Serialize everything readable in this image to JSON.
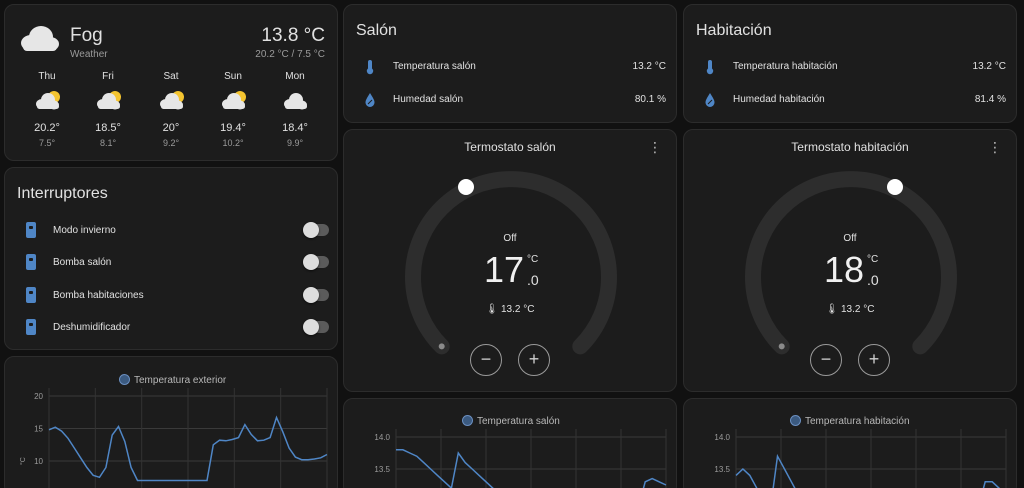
{
  "weather": {
    "condition": "Fog",
    "subtitle": "Weather",
    "temperature": "13.8 °C",
    "range": "20.2 °C / 7.5 °C",
    "forecast": [
      {
        "day": "Thu",
        "high": "20.2°",
        "low": "7.5°",
        "icon": "partly-cloudy-icon"
      },
      {
        "day": "Fri",
        "high": "18.5°",
        "low": "8.1°",
        "icon": "partly-cloudy-icon"
      },
      {
        "day": "Sat",
        "high": "20°",
        "low": "9.2°",
        "icon": "partly-cloudy-icon"
      },
      {
        "day": "Sun",
        "high": "19.4°",
        "low": "10.2°",
        "icon": "partly-cloudy-icon"
      },
      {
        "day": "Mon",
        "high": "18.4°",
        "low": "9.9°",
        "icon": "cloudy-icon"
      }
    ]
  },
  "switches": {
    "title": "Interruptores",
    "items": [
      {
        "label": "Modo invierno",
        "on": false
      },
      {
        "label": "Bomba salón",
        "on": false
      },
      {
        "label": "Bomba habitaciones",
        "on": false
      },
      {
        "label": "Deshumidificador",
        "on": false
      }
    ]
  },
  "rooms": {
    "salon": {
      "title": "Salón",
      "temp_label": "Temperatura salón",
      "temp_value": "13.2 °C",
      "hum_label": "Humedad salón",
      "hum_value": "80.1 %"
    },
    "habit": {
      "title": "Habitación",
      "temp_label": "Temperatura habitación",
      "temp_value": "13.2 °C",
      "hum_label": "Humedad habitación",
      "hum_value": "81.4 %"
    }
  },
  "thermostats": {
    "salon": {
      "title": "Termostato salón",
      "state": "Off",
      "target_int": "17",
      "unit": "°C",
      "target_dec": ".0",
      "current": "13.2 °C",
      "minus": "−",
      "plus": "+",
      "menu": "⋮"
    },
    "habit": {
      "title": "Termostato habitación",
      "state": "Off",
      "target_int": "18",
      "unit": "°C",
      "target_dec": ".0",
      "current": "13.2 °C",
      "minus": "−",
      "plus": "+",
      "menu": "⋮"
    }
  },
  "colors": {
    "accent": "#4f86c6",
    "card": "#1c1c1c",
    "background": "#111111",
    "dial_track": "#2d2d2d"
  },
  "chart_data": [
    {
      "type": "line",
      "series": [
        {
          "name": "Temperatura exterior",
          "x": [
            0,
            1,
            2,
            3,
            4,
            5,
            6,
            7,
            8,
            9,
            10,
            11,
            12,
            13,
            14,
            15,
            16,
            17,
            18,
            19,
            20,
            21,
            22,
            23,
            24,
            25,
            26,
            27,
            28,
            29,
            30,
            31,
            32,
            33,
            34,
            35,
            36,
            37,
            38,
            39,
            40,
            41,
            42,
            43,
            44
          ],
          "y": [
            14.8,
            15.2,
            14.6,
            13.5,
            12,
            10.5,
            9,
            7.8,
            7.5,
            9,
            14,
            15.3,
            13,
            9,
            7,
            7,
            7,
            7,
            7,
            7,
            7,
            7,
            7,
            7,
            7,
            7,
            12.5,
            13.2,
            13.1,
            13.3,
            13.6,
            15.6,
            14.1,
            13.1,
            13.2,
            13.6,
            16.7,
            14.5,
            12,
            10.6,
            10.2,
            10.2,
            10.3,
            10.5,
            11
          ]
        }
      ],
      "yticks": [
        "20",
        "15",
        "10"
      ],
      "ylabel": "°C"
    },
    {
      "type": "line",
      "series": [
        {
          "name": "Temperatura salón",
          "x": [
            0,
            1,
            2,
            3,
            4,
            5,
            6,
            7,
            8,
            9,
            10,
            11,
            12,
            13,
            14,
            15,
            16,
            17,
            18,
            19,
            20,
            21,
            22,
            23,
            24,
            25,
            26,
            27,
            28,
            29,
            30,
            31,
            32,
            33,
            34,
            35,
            36,
            37,
            38,
            39
          ],
          "y": [
            13.8,
            13.8,
            13.75,
            13.7,
            13.6,
            13.5,
            13.4,
            13.3,
            13.2,
            13.75,
            13.6,
            13.5,
            13.4,
            13.3,
            13.2,
            13.1,
            13.0,
            12.9,
            12.9,
            12.9,
            12.9,
            12.9,
            12.9,
            12.9,
            12.9,
            12.9,
            12.9,
            12.9,
            12.9,
            12.9,
            12.9,
            12.9,
            12.9,
            12.9,
            12.9,
            12.9,
            13.3,
            13.35,
            13.3,
            13.25
          ]
        }
      ],
      "yticks": [
        "14.0",
        "13.5"
      ]
    },
    {
      "type": "line",
      "series": [
        {
          "name": "Temperatura habitación",
          "x": [
            0,
            1,
            2,
            3,
            4,
            5,
            6,
            7,
            8,
            9,
            10,
            11,
            12,
            13,
            14,
            15,
            16,
            17,
            18,
            19,
            20,
            21,
            22,
            23,
            24,
            25,
            26,
            27,
            28,
            29,
            30,
            31,
            32,
            33,
            34,
            35,
            36,
            37,
            38,
            39
          ],
          "y": [
            13.4,
            13.5,
            13.4,
            13.2,
            13.0,
            12.9,
            13.7,
            13.5,
            13.3,
            13.1,
            12.9,
            12.9,
            12.9,
            12.9,
            12.9,
            12.9,
            12.9,
            12.9,
            12.9,
            12.9,
            12.9,
            12.9,
            12.9,
            12.9,
            12.9,
            12.9,
            12.9,
            12.9,
            12.9,
            12.9,
            12.9,
            12.9,
            12.9,
            12.9,
            12.9,
            12.9,
            13.3,
            13.3,
            13.2,
            13.1
          ]
        }
      ],
      "yticks": [
        "14.0",
        "13.5"
      ]
    }
  ]
}
